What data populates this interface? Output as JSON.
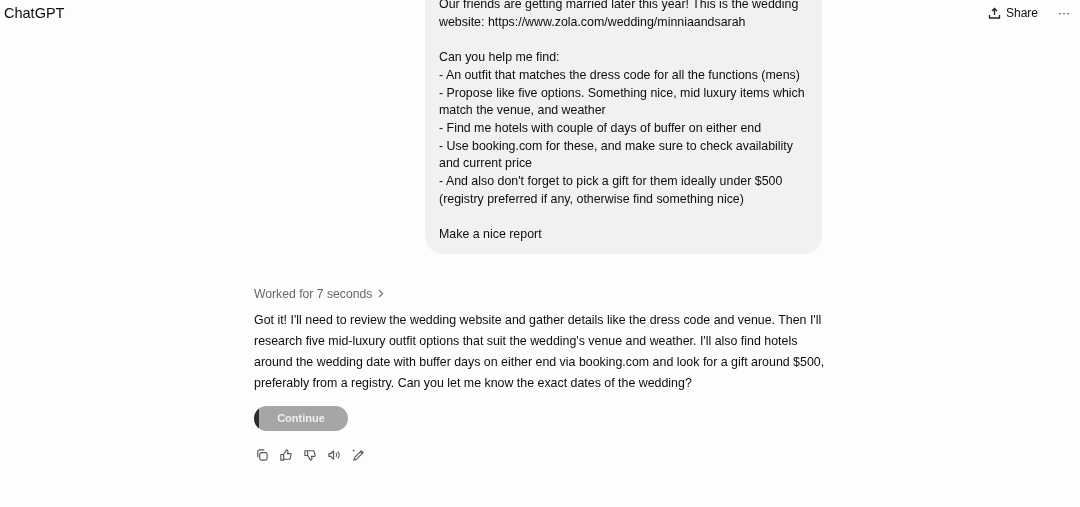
{
  "header": {
    "title": "ChatGPT",
    "share_label": "Share",
    "more_label": "···"
  },
  "user_message": {
    "paragraphs": [
      [
        "Our friends are getting married later this year! This is the wedding",
        "website: https://www.zola.com/wedding/minniaandsarah"
      ],
      [
        "Can you help me find:",
        "- An outfit that matches the dress code for all the functions (mens)",
        "- Propose like five options. Something nice, mid luxury items which",
        "match the venue, and weather",
        "- Find me hotels with couple of days of buffer on either end",
        "- Use booking.com for these, and make sure to check availability",
        "and current price",
        "- And also don't forget to pick a gift for them ideally under $500",
        "(registry preferred if any, otherwise find something nice)"
      ],
      [
        "Make a nice report"
      ]
    ]
  },
  "assistant": {
    "worked_label": "Worked for 7 seconds",
    "reply": "Got it! I'll need to review the wedding website and gather details like the dress code and venue. Then I'll research five mid-luxury outfit options that suit the wedding's venue and weather. I'll also find hotels around the wedding date with buffer days on either end via booking.com and look for a gift around $500, preferably from a registry. Can you let me know the exact dates of the wedding?",
    "continue_button": {
      "label": "Continue",
      "level": 0.05
    },
    "actions": [
      {
        "kind": "copy"
      },
      {
        "kind": "like"
      },
      {
        "kind": "dislike"
      },
      {
        "kind": "speak"
      },
      {
        "kind": "edit"
      }
    ]
  }
}
